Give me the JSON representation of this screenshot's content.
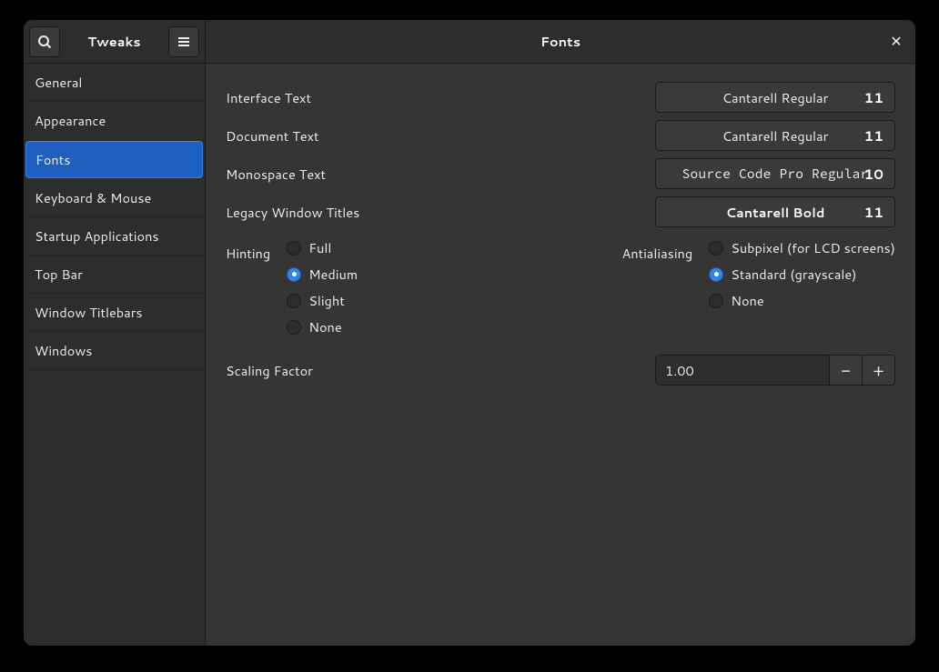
{
  "sidebar": {
    "title": "Tweaks",
    "items": [
      {
        "label": "General"
      },
      {
        "label": "Appearance"
      },
      {
        "label": "Fonts"
      },
      {
        "label": "Keyboard & Mouse"
      },
      {
        "label": "Startup Applications"
      },
      {
        "label": "Top Bar"
      },
      {
        "label": "Window Titlebars"
      },
      {
        "label": "Windows"
      }
    ],
    "active_index": 2
  },
  "main": {
    "title": "Fonts",
    "fonts": {
      "interface": {
        "label": "Interface Text",
        "name": "Cantarell Regular",
        "size": "11"
      },
      "document": {
        "label": "Document Text",
        "name": "Cantarell Regular",
        "size": "11"
      },
      "monospace": {
        "label": "Monospace Text",
        "name": "Source Code Pro Regular",
        "size": "10"
      },
      "legacy": {
        "label": "Legacy Window Titles",
        "name": "Cantarell Bold",
        "size": "11"
      }
    },
    "hinting": {
      "label": "Hinting",
      "options": [
        "Full",
        "Medium",
        "Slight",
        "None"
      ],
      "selected": 1
    },
    "antialiasing": {
      "label": "Antialiasing",
      "options": [
        "Subpixel (for LCD screens)",
        "Standard (grayscale)",
        "None"
      ],
      "selected": 1
    },
    "scaling": {
      "label": "Scaling Factor",
      "value": "1.00"
    }
  }
}
